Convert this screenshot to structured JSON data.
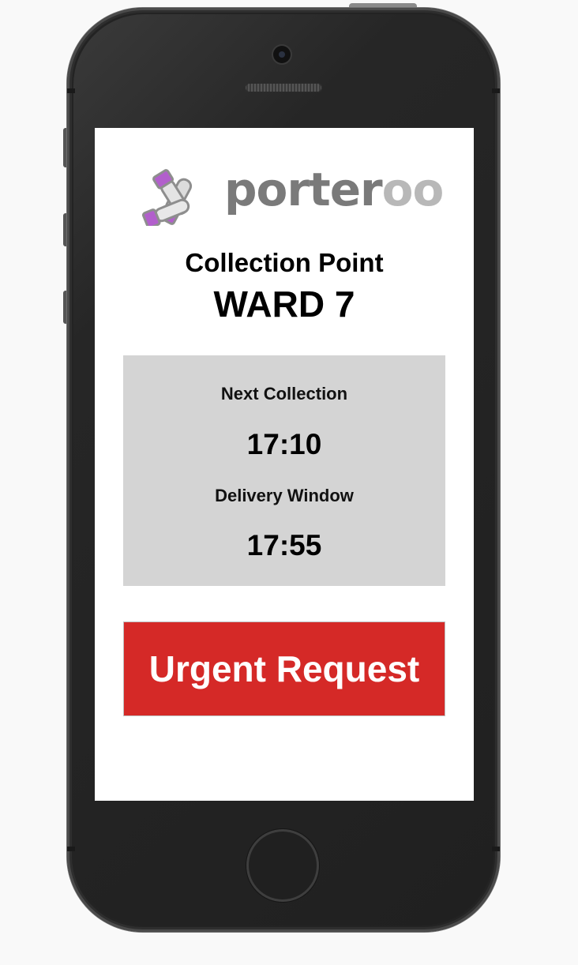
{
  "app": {
    "logo_text_part1": "porter",
    "logo_text_part2": "oo",
    "logo_icon": "sample-tubes-icon"
  },
  "collection": {
    "heading": "Collection Point",
    "ward": "WARD 7"
  },
  "schedule": {
    "next_label": "Next Collection",
    "next_time": "17:10",
    "window_label": "Delivery Window",
    "window_time": "17:55"
  },
  "actions": {
    "urgent_label": "Urgent Request"
  },
  "colors": {
    "urgent": "#d52927",
    "info_panel": "#d4d4d4",
    "logo_dark": "#7a7a7a",
    "logo_light": "#b8b8b8",
    "tube_cap": "#b25fcc"
  },
  "device": {
    "camera_icon": "camera-icon",
    "speaker_icon": "speaker-grille-icon",
    "home_icon": "home-button-icon"
  }
}
